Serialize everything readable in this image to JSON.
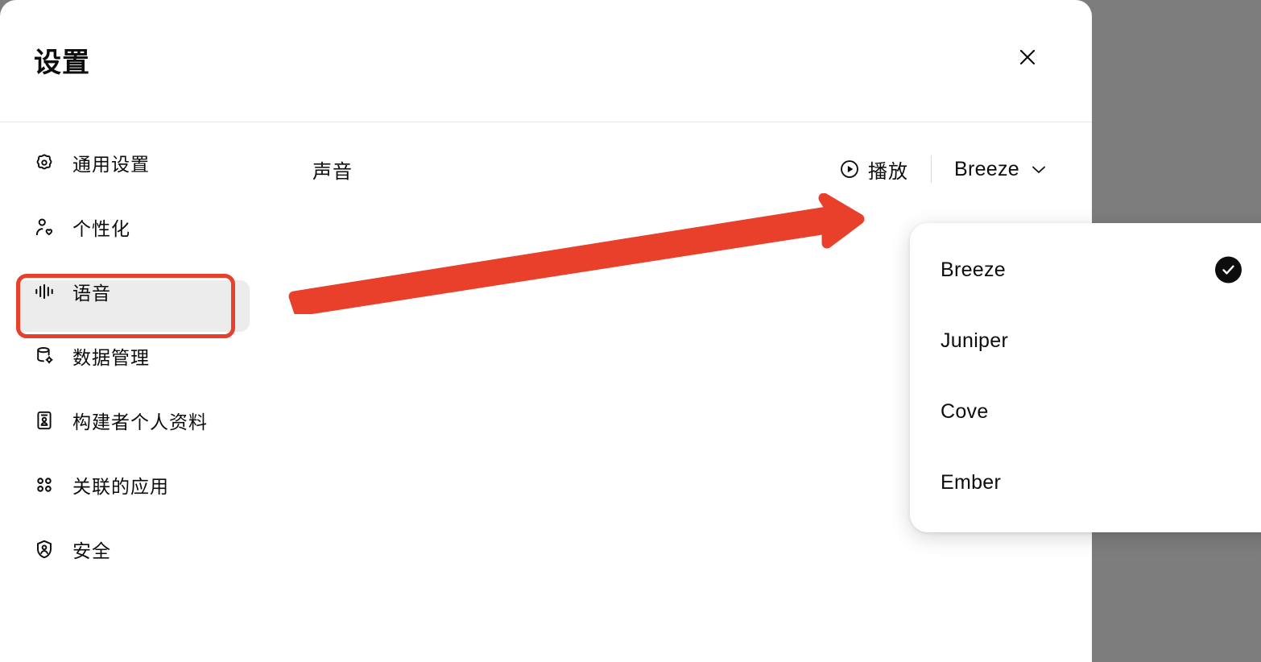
{
  "window": {
    "title": "设置",
    "close_label": "×",
    "close_icon": "close-icon"
  },
  "sidebar": {
    "items": [
      {
        "label": "通用设置",
        "icon": "gear-icon",
        "selected": false
      },
      {
        "label": "个性化",
        "icon": "person-heart-icon",
        "selected": false
      },
      {
        "label": "语音",
        "icon": "voice-waveform-icon",
        "selected": true
      },
      {
        "label": "数据管理",
        "icon": "database-gear-icon",
        "selected": false
      },
      {
        "label": "构建者个人资料",
        "icon": "id-card-icon",
        "selected": false
      },
      {
        "label": "关联的应用",
        "icon": "apps-grid-icon",
        "selected": false
      },
      {
        "label": "安全",
        "icon": "shield-person-icon",
        "selected": false
      }
    ]
  },
  "main": {
    "voice_section_label": "声音",
    "play_button_label": "播放",
    "play_icon": "play-circle-icon",
    "selected_voice": "Breeze",
    "chevron_icon": "chevron-down-icon"
  },
  "dropdown": {
    "open": true,
    "options": [
      {
        "label": "Breeze",
        "checked": true
      },
      {
        "label": "Juniper",
        "checked": false
      },
      {
        "label": "Cove",
        "checked": false
      },
      {
        "label": "Ember",
        "checked": false
      }
    ],
    "check_icon": "check-icon"
  },
  "annotations": {
    "highlight_color": "#e8402a",
    "arrow_color": "#e8402a",
    "highlight_target": "语音",
    "arrow_target": "播放"
  },
  "colors": {
    "backdrop": "#7d7d7d",
    "modal_bg": "#ffffff",
    "selected_item_bg": "#ececec",
    "text": "#0d0d0d",
    "divider": "#e8e8e8"
  }
}
